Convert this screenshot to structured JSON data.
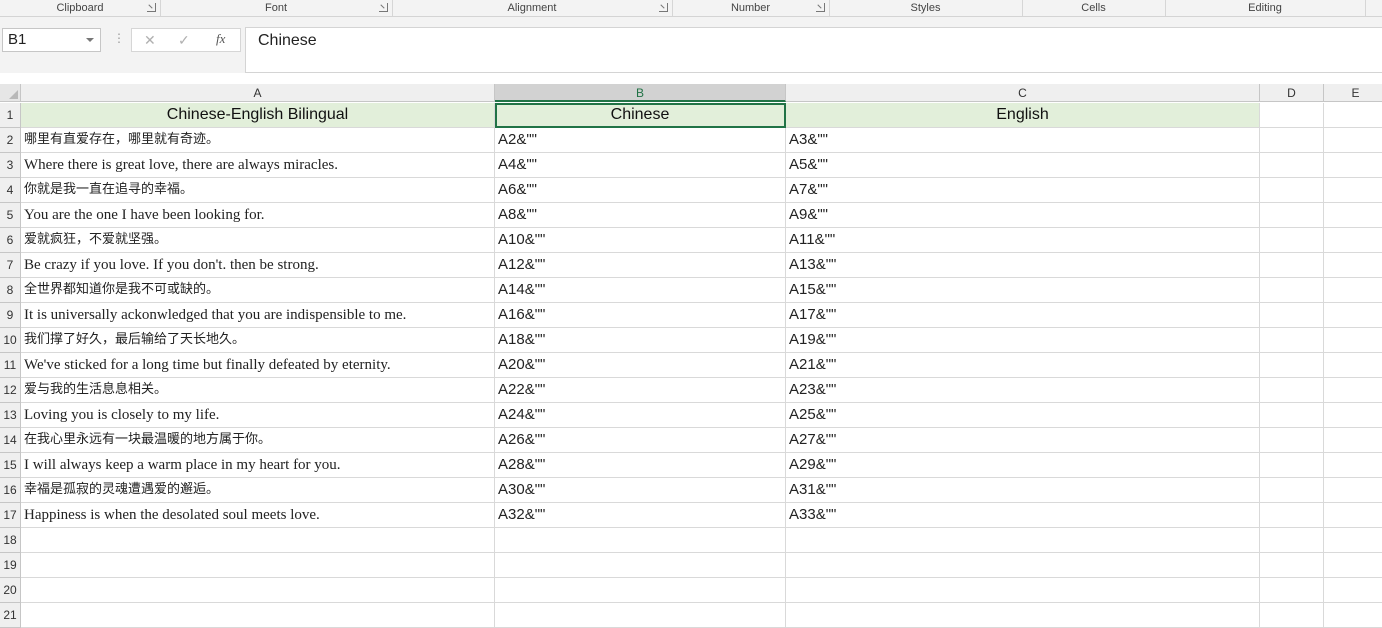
{
  "ribbon": {
    "groups": [
      "Clipboard",
      "Font",
      "Alignment",
      "Number",
      "Styles",
      "Cells",
      "Editing"
    ]
  },
  "formula_bar": {
    "name_box": "B1",
    "fx_label": "fx",
    "cancel_glyph": "✕",
    "enter_glyph": "✓",
    "more_glyph": "⋮",
    "content": "Chinese"
  },
  "grid": {
    "columns": [
      "A",
      "B",
      "C",
      "D",
      "E"
    ],
    "selected_column": "B",
    "row_numbers": [
      "1",
      "2",
      "3",
      "4",
      "5",
      "6",
      "7",
      "8",
      "9",
      "10",
      "11",
      "12",
      "13",
      "14",
      "15",
      "16",
      "17",
      "18",
      "19",
      "20",
      "21"
    ],
    "header_row": [
      "Chinese-English Bilingual",
      "Chinese",
      "English"
    ],
    "rows": [
      {
        "a": "哪里有直爱存在，哪里就有奇迹。",
        "b": "A2&\"\"",
        "c": "A3&\"\""
      },
      {
        "a": "Where there is great love, there are always miracles.",
        "b": "A4&\"\"",
        "c": "A5&\"\""
      },
      {
        "a": "你就是我一直在追寻的幸福。",
        "b": "A6&\"\"",
        "c": "A7&\"\""
      },
      {
        "a": "You are the one I have been looking for.",
        "b": "A8&\"\"",
        "c": "A9&\"\""
      },
      {
        "a": "爱就疯狂，不爱就坚强。",
        "b": "A10&\"\"",
        "c": "A11&\"\""
      },
      {
        "a": "Be crazy if you love. If you don't. then be strong.",
        "b": "A12&\"\"",
        "c": "A13&\"\""
      },
      {
        "a": "全世界都知道你是我不可或缺的。",
        "b": "A14&\"\"",
        "c": "A15&\"\""
      },
      {
        "a": "It is universally ackonwledged that you are indispensible to me.",
        "b": "A16&\"\"",
        "c": "A17&\"\""
      },
      {
        "a": "我们撑了好久，最后输给了天长地久。",
        "b": "A18&\"\"",
        "c": "A19&\"\""
      },
      {
        "a": "We've sticked for a long time but finally defeated by eternity.",
        "b": "A20&\"\"",
        "c": "A21&\"\""
      },
      {
        "a": "爱与我的生活息息相关。",
        "b": "A22&\"\"",
        "c": "A23&\"\""
      },
      {
        "a": "Loving you is closely to my life.",
        "b": "A24&\"\"",
        "c": "A25&\"\""
      },
      {
        "a": "在我心里永远有一块最温暖的地方属于你。",
        "b": "A26&\"\"",
        "c": "A27&\"\""
      },
      {
        "a": "I will always keep a warm place in my heart for you.",
        "b": "A28&\"\"",
        "c": "A29&\"\""
      },
      {
        "a": "幸福是孤寂的灵魂遭遇爱的邂逅。",
        "b": "A30&\"\"",
        "c": "A31&\"\""
      },
      {
        "a": "Happiness is when the desolated soul meets love.",
        "b": "A32&\"\"",
        "c": "A33&\"\""
      }
    ]
  }
}
